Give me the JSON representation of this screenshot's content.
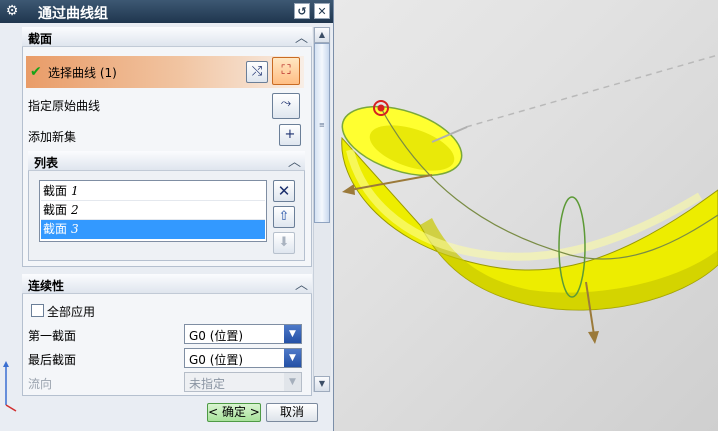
{
  "dialog": {
    "title": "通过曲线组",
    "section_curves": {
      "heading": "截面",
      "select_curve_label": "选择曲线 (1)",
      "specify_origin_label": "指定原始曲线",
      "add_new_set_label": "添加新集"
    },
    "list": {
      "heading": "列表",
      "items": [
        {
          "label": "截面",
          "index": "1",
          "selected": false
        },
        {
          "label": "截面",
          "index": "2",
          "selected": false
        },
        {
          "label": "截面",
          "index": "3",
          "selected": true
        }
      ]
    },
    "continuity": {
      "heading": "连续性",
      "apply_all_label": "全部应用",
      "apply_all_checked": false,
      "first_section_label": "第一截面",
      "first_section_value": "G0 (位置)",
      "last_section_label": "最后截面",
      "last_section_value": "G0 (位置)",
      "flow_label": "流向",
      "flow_value": "未指定"
    },
    "buttons": {
      "ok": "< 确定 >",
      "cancel": "取消"
    }
  },
  "colors": {
    "surface_fill": "#f4f400",
    "title_bar": "#2b4560",
    "selection_highlight": "#3399ff",
    "active_row": "#e99c68"
  }
}
